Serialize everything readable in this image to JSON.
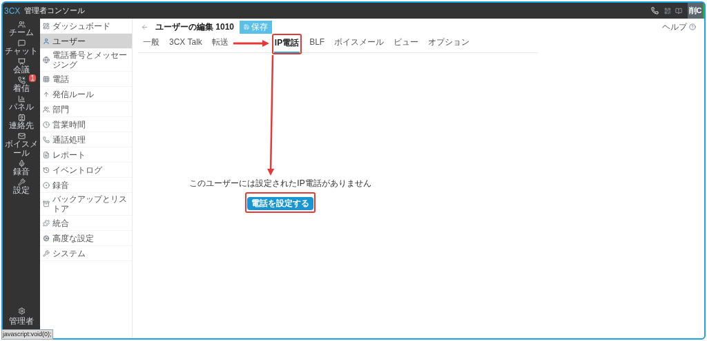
{
  "app": {
    "logo": "3CX",
    "title": "管理者コンソール",
    "user_initials": "削C"
  },
  "rail": [
    {
      "kind": "team",
      "label": "チーム"
    },
    {
      "kind": "chat",
      "label": "チャット"
    },
    {
      "kind": "meeting",
      "label": "会議"
    },
    {
      "kind": "calls",
      "label": "着信",
      "badge": "1"
    },
    {
      "kind": "panel",
      "label": "パネル"
    },
    {
      "kind": "contacts",
      "label": "連絡先"
    },
    {
      "kind": "voicemail",
      "label": "ボイスメール"
    },
    {
      "kind": "recording",
      "label": "録音"
    },
    {
      "kind": "settings",
      "label": "設定"
    }
  ],
  "rail_bottom": {
    "label": "管理者"
  },
  "sidebar": [
    {
      "kind": "dashboard",
      "label": "ダッシュボード",
      "selected": false
    },
    {
      "kind": "user",
      "label": "ユーザー",
      "selected": true
    },
    {
      "kind": "globe",
      "label": "電話番号とメッセージング",
      "selected": false
    },
    {
      "kind": "phone-grid",
      "label": "電話",
      "selected": false
    },
    {
      "kind": "up",
      "label": "発信ルール",
      "selected": false
    },
    {
      "kind": "people",
      "label": "部門",
      "selected": false
    },
    {
      "kind": "clock",
      "label": "営業時間",
      "selected": false
    },
    {
      "kind": "phone",
      "label": "通話処理",
      "selected": false
    },
    {
      "kind": "report",
      "label": "レポート",
      "selected": false
    },
    {
      "kind": "history",
      "label": "イベントログ",
      "selected": false
    },
    {
      "kind": "record",
      "label": "録音",
      "selected": false
    },
    {
      "kind": "archive",
      "label": "バックアップとリストア",
      "selected": false
    },
    {
      "kind": "puzzle",
      "label": "統合",
      "selected": false
    },
    {
      "kind": "gear",
      "label": "高度な設定",
      "selected": false
    },
    {
      "kind": "wrench",
      "label": "システム",
      "selected": false
    }
  ],
  "header": {
    "title": "ユーザーの編集 1010",
    "save": "保存",
    "help": "ヘルプ"
  },
  "tabs": [
    {
      "label": "一般",
      "selected": false
    },
    {
      "label": "3CX Talk",
      "selected": false
    },
    {
      "label": "転送",
      "selected": false
    },
    {
      "kind": "hidden"
    },
    {
      "label": "IP電話",
      "selected": true
    },
    {
      "label": "BLF",
      "selected": false
    },
    {
      "label": "ボイスメール",
      "selected": false
    },
    {
      "label": "ビュー",
      "selected": false
    },
    {
      "label": "オプション",
      "selected": false
    }
  ],
  "empty": {
    "message": "このユーザーには設定されたIP電話がありません",
    "button": "電話を設定する"
  },
  "status_url": "javascript:void(0);"
}
